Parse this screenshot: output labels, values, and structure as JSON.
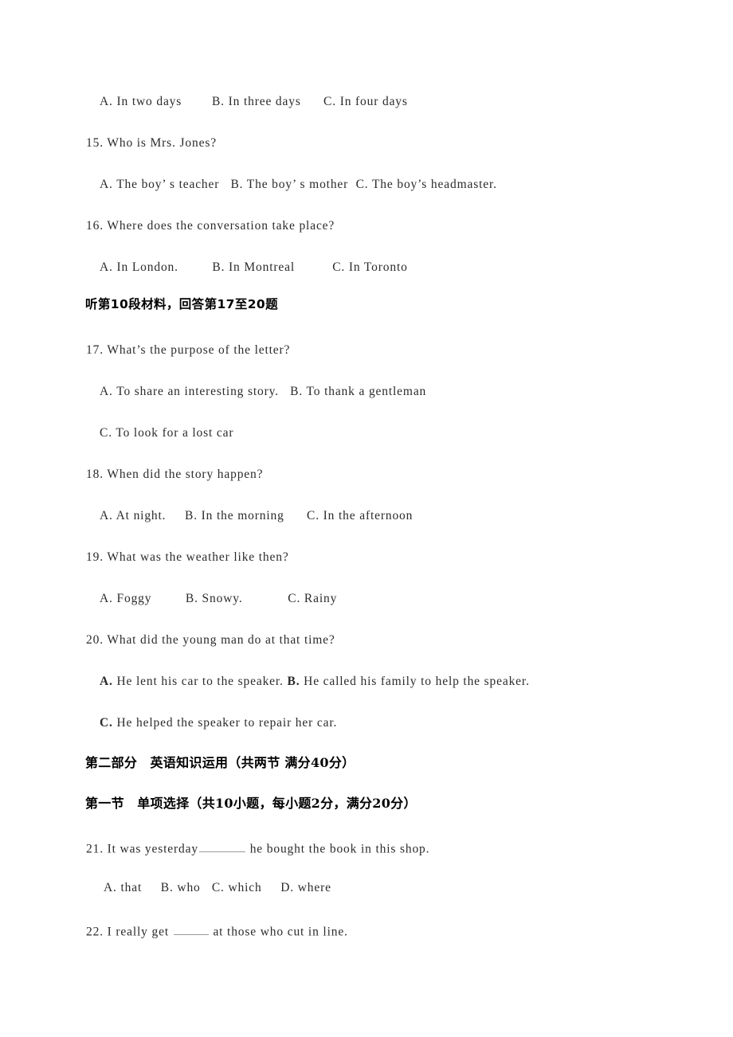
{
  "document": {
    "type": "english-exam-paper",
    "language": "zh-CN + en",
    "page_background": "#ffffff",
    "text_color": "#2b2b2b"
  },
  "listening_section": {
    "q14_options_line": "A. In two days        B. In three days      C. In four days",
    "q15": {
      "number_and_stem": "15. Who is Mrs. Jones?",
      "options_line": "A. The boy’ s teacher   B. The boy’ s mother  C. The boy’s headmaster."
    },
    "q16": {
      "number_and_stem": "16. Where does the conversation take place?",
      "options_line": "A. In London.         B. In Montreal          C. In Toronto"
    },
    "material_heading": "听第10段材料，回答第17至20题",
    "q17": {
      "number_and_stem": "17. What’s the purpose of the letter?",
      "options_line_1": "A. To share an interesting story.   B. To thank a gentleman",
      "options_line_2": "C. To look for a lost car"
    },
    "q18": {
      "number_and_stem": "18. When did the story happen?",
      "options_line": "A. At night.     B. In the morning      C. In the afternoon"
    },
    "q19": {
      "number_and_stem": "19. What was the weather like then?",
      "options_line": "A. Foggy         B. Snowy.            C. Rainy"
    },
    "q20": {
      "number_and_stem": "20. What did the young man do at that time?",
      "option_a_marker": "A.",
      "option_a_text": " He lent his car to the speaker. ",
      "option_b_marker": "B.",
      "option_b_text": " He called his family to help the speaker.",
      "option_c_marker": "C.",
      "option_c_text": " He helped the speaker to repair her car."
    }
  },
  "part_two": {
    "part_heading": "第二部分　英语知识运用（共两节 满分40分）",
    "section_heading": "第一节　单项选择（共10小题，每小题2分，满分20分）",
    "q21": {
      "stem_before_blank": "21. It was yesterday",
      "stem_after_blank": " he bought the book in this shop.",
      "options_line": "A. that     B. who   C. which     D. where"
    },
    "q22": {
      "stem_before_blank": "22. I really get ",
      "stem_after_blank": " at those who cut in line."
    }
  }
}
